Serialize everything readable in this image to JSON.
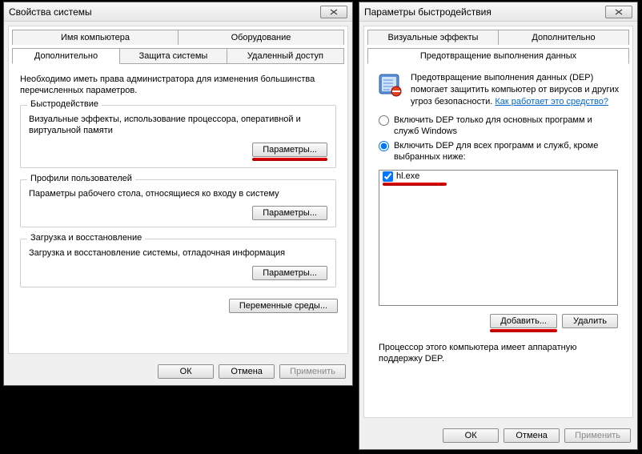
{
  "left": {
    "title": "Свойства системы",
    "tabs_row1": [
      "Имя компьютера",
      "Оборудование"
    ],
    "tabs_row2": [
      "Дополнительно",
      "Защита системы",
      "Удаленный доступ"
    ],
    "intro": "Необходимо иметь права администратора для изменения большинства перечисленных параметров.",
    "group1": {
      "title": "Быстродействие",
      "desc": "Визуальные эффекты, использование процессора, оперативной и виртуальной памяти",
      "btn": "Параметры..."
    },
    "group2": {
      "title": "Профили пользователей",
      "desc": "Параметры рабочего стола, относящиеся ко входу в систему",
      "btn": "Параметры..."
    },
    "group3": {
      "title": "Загрузка и восстановление",
      "desc": "Загрузка и восстановление системы, отладочная информация",
      "btn": "Параметры..."
    },
    "env_btn": "Переменные среды...",
    "ok": "ОК",
    "cancel": "Отмена",
    "apply": "Применить"
  },
  "right": {
    "title": "Параметры быстродействия",
    "tabs_row1": [
      "Визуальные эффекты",
      "Дополнительно"
    ],
    "tab_active": "Предотвращение выполнения данных",
    "dep_info": "Предотвращение выполнения данных (DEP) помогает защитить компьютер от вирусов и других угроз безопасности.",
    "dep_link": "Как работает это средство?",
    "radio1": "Включить DEP только для основных программ и служб Windows",
    "radio2": "Включить DEP для всех программ и служб, кроме выбранных ниже:",
    "list_item": "hl.exe",
    "add_btn": "Добавить...",
    "del_btn": "Удалить",
    "note": "Процессор этого компьютера имеет аппаратную поддержку DEP.",
    "ok": "ОК",
    "cancel": "Отмена",
    "apply": "Применить"
  }
}
